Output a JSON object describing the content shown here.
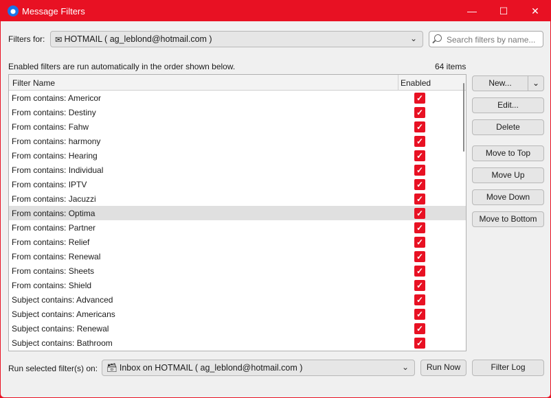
{
  "window": {
    "title": "Message Filters",
    "minimize": "—",
    "maximize": "☐",
    "close": "✕"
  },
  "filters_for": {
    "label": "Filters for:",
    "value": "HOTMAIL ( ag_leblond@hotmail.com )"
  },
  "search": {
    "placeholder": "Search filters by name..."
  },
  "info_text": "Enabled filters are run automatically in the order shown below.",
  "item_count": "64 items",
  "columns": {
    "name": "Filter Name",
    "enabled": "Enabled"
  },
  "rows": [
    {
      "name": "From contains: Americor",
      "enabled": true
    },
    {
      "name": "From contains: Destiny",
      "enabled": true
    },
    {
      "name": "From contains: Fahw",
      "enabled": true
    },
    {
      "name": "From contains: harmony",
      "enabled": true
    },
    {
      "name": "From contains: Hearing",
      "enabled": true
    },
    {
      "name": "From contains: Individual",
      "enabled": true
    },
    {
      "name": "From contains: IPTV",
      "enabled": true
    },
    {
      "name": "From contains: Jacuzzi",
      "enabled": true
    },
    {
      "name": "From contains: Optima",
      "enabled": true,
      "selected": true
    },
    {
      "name": "From contains: Partner",
      "enabled": true
    },
    {
      "name": "From contains: Relief",
      "enabled": true
    },
    {
      "name": "From contains: Renewal",
      "enabled": true
    },
    {
      "name": "From contains: Sheets",
      "enabled": true
    },
    {
      "name": "From contains: Shield",
      "enabled": true
    },
    {
      "name": "Subject contains: Advanced",
      "enabled": true
    },
    {
      "name": "Subject contains: Americans",
      "enabled": true
    },
    {
      "name": "Subject contains: Renewal",
      "enabled": true
    },
    {
      "name": "Subject contains: Bathroom",
      "enabled": true
    }
  ],
  "buttons": {
    "new": "New...",
    "edit": "Edit...",
    "delete": "Delete",
    "move_top": "Move to Top",
    "move_up": "Move Up",
    "move_down": "Move Down",
    "move_bottom": "Move to Bottom",
    "run_now": "Run Now",
    "filter_log": "Filter Log"
  },
  "run_on": {
    "label": "Run selected filter(s) on:",
    "value": "Inbox on HOTMAIL ( ag_leblond@hotmail.com )"
  },
  "colors": {
    "accent": "#e81123"
  }
}
